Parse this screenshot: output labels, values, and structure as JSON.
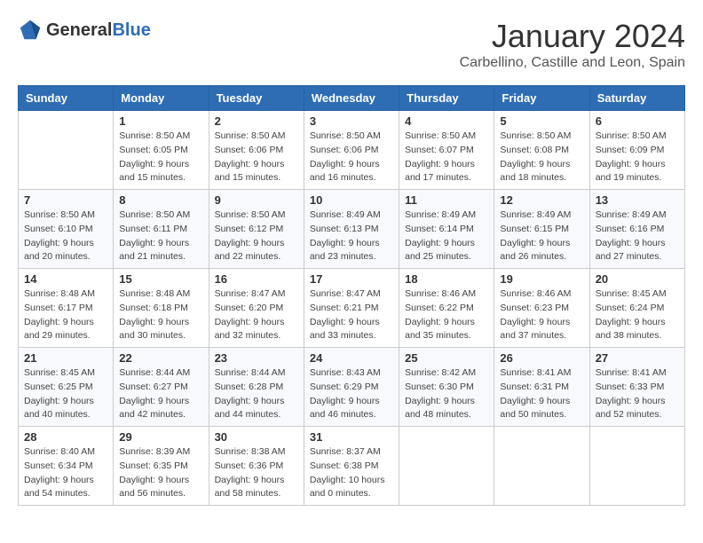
{
  "header": {
    "logo_general": "General",
    "logo_blue": "Blue",
    "month_title": "January 2024",
    "location": "Carbellino, Castille and Leon, Spain"
  },
  "weekdays": [
    "Sunday",
    "Monday",
    "Tuesday",
    "Wednesday",
    "Thursday",
    "Friday",
    "Saturday"
  ],
  "weeks": [
    [
      {
        "day": "",
        "info": ""
      },
      {
        "day": "1",
        "info": "Sunrise: 8:50 AM\nSunset: 6:05 PM\nDaylight: 9 hours\nand 15 minutes."
      },
      {
        "day": "2",
        "info": "Sunrise: 8:50 AM\nSunset: 6:06 PM\nDaylight: 9 hours\nand 15 minutes."
      },
      {
        "day": "3",
        "info": "Sunrise: 8:50 AM\nSunset: 6:06 PM\nDaylight: 9 hours\nand 16 minutes."
      },
      {
        "day": "4",
        "info": "Sunrise: 8:50 AM\nSunset: 6:07 PM\nDaylight: 9 hours\nand 17 minutes."
      },
      {
        "day": "5",
        "info": "Sunrise: 8:50 AM\nSunset: 6:08 PM\nDaylight: 9 hours\nand 18 minutes."
      },
      {
        "day": "6",
        "info": "Sunrise: 8:50 AM\nSunset: 6:09 PM\nDaylight: 9 hours\nand 19 minutes."
      }
    ],
    [
      {
        "day": "7",
        "info": "Sunrise: 8:50 AM\nSunset: 6:10 PM\nDaylight: 9 hours\nand 20 minutes."
      },
      {
        "day": "8",
        "info": "Sunrise: 8:50 AM\nSunset: 6:11 PM\nDaylight: 9 hours\nand 21 minutes."
      },
      {
        "day": "9",
        "info": "Sunrise: 8:50 AM\nSunset: 6:12 PM\nDaylight: 9 hours\nand 22 minutes."
      },
      {
        "day": "10",
        "info": "Sunrise: 8:49 AM\nSunset: 6:13 PM\nDaylight: 9 hours\nand 23 minutes."
      },
      {
        "day": "11",
        "info": "Sunrise: 8:49 AM\nSunset: 6:14 PM\nDaylight: 9 hours\nand 25 minutes."
      },
      {
        "day": "12",
        "info": "Sunrise: 8:49 AM\nSunset: 6:15 PM\nDaylight: 9 hours\nand 26 minutes."
      },
      {
        "day": "13",
        "info": "Sunrise: 8:49 AM\nSunset: 6:16 PM\nDaylight: 9 hours\nand 27 minutes."
      }
    ],
    [
      {
        "day": "14",
        "info": "Sunrise: 8:48 AM\nSunset: 6:17 PM\nDaylight: 9 hours\nand 29 minutes."
      },
      {
        "day": "15",
        "info": "Sunrise: 8:48 AM\nSunset: 6:18 PM\nDaylight: 9 hours\nand 30 minutes."
      },
      {
        "day": "16",
        "info": "Sunrise: 8:47 AM\nSunset: 6:20 PM\nDaylight: 9 hours\nand 32 minutes."
      },
      {
        "day": "17",
        "info": "Sunrise: 8:47 AM\nSunset: 6:21 PM\nDaylight: 9 hours\nand 33 minutes."
      },
      {
        "day": "18",
        "info": "Sunrise: 8:46 AM\nSunset: 6:22 PM\nDaylight: 9 hours\nand 35 minutes."
      },
      {
        "day": "19",
        "info": "Sunrise: 8:46 AM\nSunset: 6:23 PM\nDaylight: 9 hours\nand 37 minutes."
      },
      {
        "day": "20",
        "info": "Sunrise: 8:45 AM\nSunset: 6:24 PM\nDaylight: 9 hours\nand 38 minutes."
      }
    ],
    [
      {
        "day": "21",
        "info": "Sunrise: 8:45 AM\nSunset: 6:25 PM\nDaylight: 9 hours\nand 40 minutes."
      },
      {
        "day": "22",
        "info": "Sunrise: 8:44 AM\nSunset: 6:27 PM\nDaylight: 9 hours\nand 42 minutes."
      },
      {
        "day": "23",
        "info": "Sunrise: 8:44 AM\nSunset: 6:28 PM\nDaylight: 9 hours\nand 44 minutes."
      },
      {
        "day": "24",
        "info": "Sunrise: 8:43 AM\nSunset: 6:29 PM\nDaylight: 9 hours\nand 46 minutes."
      },
      {
        "day": "25",
        "info": "Sunrise: 8:42 AM\nSunset: 6:30 PM\nDaylight: 9 hours\nand 48 minutes."
      },
      {
        "day": "26",
        "info": "Sunrise: 8:41 AM\nSunset: 6:31 PM\nDaylight: 9 hours\nand 50 minutes."
      },
      {
        "day": "27",
        "info": "Sunrise: 8:41 AM\nSunset: 6:33 PM\nDaylight: 9 hours\nand 52 minutes."
      }
    ],
    [
      {
        "day": "28",
        "info": "Sunrise: 8:40 AM\nSunset: 6:34 PM\nDaylight: 9 hours\nand 54 minutes."
      },
      {
        "day": "29",
        "info": "Sunrise: 8:39 AM\nSunset: 6:35 PM\nDaylight: 9 hours\nand 56 minutes."
      },
      {
        "day": "30",
        "info": "Sunrise: 8:38 AM\nSunset: 6:36 PM\nDaylight: 9 hours\nand 58 minutes."
      },
      {
        "day": "31",
        "info": "Sunrise: 8:37 AM\nSunset: 6:38 PM\nDaylight: 10 hours\nand 0 minutes."
      },
      {
        "day": "",
        "info": ""
      },
      {
        "day": "",
        "info": ""
      },
      {
        "day": "",
        "info": ""
      }
    ]
  ]
}
